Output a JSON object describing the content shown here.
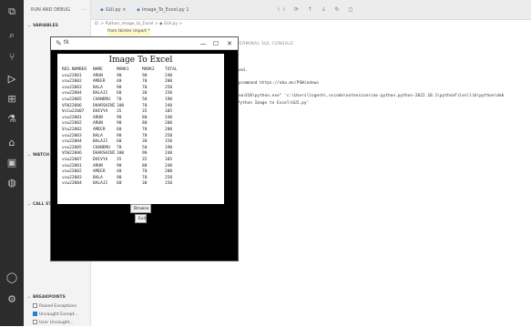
{
  "activity": {
    "icons": [
      "files-icon",
      "search-icon",
      "source-control-icon",
      "run-debug-icon",
      "extensions-icon",
      "testing-icon",
      "remote-icon",
      "docker-icon",
      "database-icon",
      "account-icon",
      "settings-icon"
    ]
  },
  "sidebar": {
    "run_label": "RUN AND DEBUG",
    "more": "···",
    "variables": "VARIABLES",
    "watch": "WATCH",
    "callstack": "CALL STACK",
    "breakpoints": "BREAKPOINTS",
    "bp_items": [
      {
        "label": "Raised Exceptions",
        "checked": false
      },
      {
        "label": "Uncaught Except...",
        "checked": true
      },
      {
        "label": "User Uncaught...",
        "checked": false
      }
    ]
  },
  "tabs": [
    {
      "label": "GUI.py",
      "close": "×"
    },
    {
      "label": "Image_To_Excel.py 1",
      "close": ""
    }
  ],
  "toolbar": "⁞⁞ ⟳ ↑ ↓ ↻ ◻",
  "breadcrumb": "D: > Python_image_to_Excel > ◆ GUI.py >",
  "code_line": "from tkinter import *",
  "panel_tabs": "TERMINAL  SQL CONSOLE",
  "output": [
    "rved.",
    "ngcommand https://aka.ms/PSWindows",
    "thon310\\python.exe\" 'c:\\Users\\logesh\\.vscode\\extensions\\ms-python.python-2022.10.1\\pythonFiles\\lib\\python\\deb",
    "\\Python Image to Excel\\GUI.py'"
  ],
  "window": {
    "title": "tk",
    "minimize": "—",
    "maximize": "☐",
    "close": "✕"
  },
  "app": {
    "heading": "Image To Excel",
    "columns": [
      "REG.NUMBER",
      "NAME",
      "MARK1",
      "MARK2",
      "TOTAL"
    ],
    "rows": [
      [
        "vcw22001",
        "ARUN",
        "90",
        "90",
        "240"
      ],
      [
        "vcw22002",
        "AMEER",
        "40",
        "70",
        "200"
      ],
      [
        "vcw22003",
        "BALA",
        "90",
        "70",
        "250"
      ],
      [
        "vcw22004",
        "BALAJI",
        "60",
        "30",
        "150"
      ],
      [
        "vcw22005",
        "CHANDRU",
        "70",
        "50",
        "190"
      ],
      [
        "VCW22006",
        "DHARSHINI",
        "100",
        "70",
        "240"
      ],
      [
        "VcCw22007",
        "DHIVYA",
        "35",
        "35",
        "105"
      ],
      [
        "vcw22001",
        "ARUN",
        "90",
        "80",
        "240"
      ],
      [
        "vcw22002",
        "ARUN",
        "90",
        "80",
        "200"
      ],
      [
        "Vcw22002",
        "AMEER",
        "60",
        "70",
        "200"
      ],
      [
        "vcw22003",
        "BALA",
        "90",
        "70",
        "250"
      ],
      [
        "vcw22004",
        "BALAJI",
        "60",
        "30",
        "150"
      ],
      [
        "vcw22005",
        "CHANDRU",
        "70",
        "50",
        "190"
      ],
      [
        "VCW22006",
        "DHARSHINI",
        "100",
        "90",
        "240"
      ],
      [
        "vcw22007",
        "DHIVYA",
        "35",
        "35",
        "105"
      ],
      [
        "vcw22001",
        "ARUN",
        "90",
        "80",
        "240"
      ],
      [
        "vcw22002",
        "AMEER",
        "40",
        "70",
        "200"
      ],
      [
        "vcw22003",
        "BALA",
        "90",
        "70",
        "250"
      ],
      [
        "vcw22004",
        "BALAJI",
        "60",
        "30",
        "150"
      ]
    ],
    "browse_label": "Browse",
    "exit_label": "Exit"
  }
}
